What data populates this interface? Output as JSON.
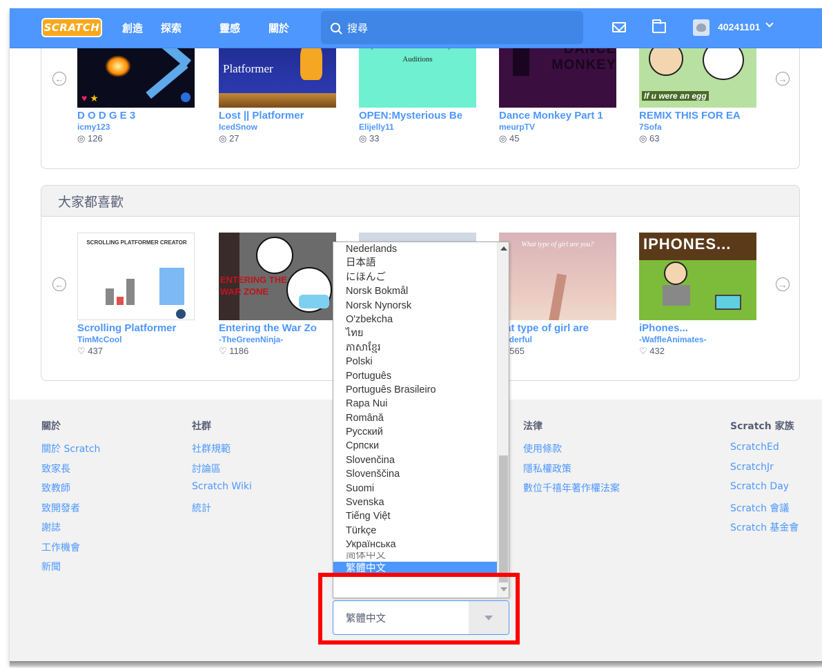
{
  "nav": {
    "logo": "SCRATCH",
    "links": [
      "創造",
      "探索",
      "靈感",
      "關於"
    ],
    "search_placeholder": "搜尋",
    "username": "40241101"
  },
  "top_row": [
    {
      "title": "D O D G E 3",
      "author": "icmy123",
      "stat": "126",
      "thumb_text": ""
    },
    {
      "title": "Lost || Platformer",
      "author": "IcedSnow",
      "stat": "27",
      "thumb_text": "Platformer"
    },
    {
      "title": "OPEN:Mysterious Be",
      "author": "Elijelly11",
      "stat": "33",
      "thumb_text": "Mysterious Benedict Society Voice Auditions"
    },
    {
      "title": "Dance Monkey Part 1",
      "author": "meurpTV",
      "stat": "45",
      "thumb_text": "DANCE MONKEY"
    },
    {
      "title": "REMIX THIS FOR EA",
      "author": "7Sofa",
      "stat": "63",
      "thumb_text": "If u were an egg"
    }
  ],
  "section2": {
    "title": "大家都喜歡",
    "cards": [
      {
        "title": "Scrolling Platformer",
        "author": "TimMcCool",
        "stat": "437",
        "thumb_text": "SCROLLING PLATFORMER CREATOR"
      },
      {
        "title": "Entering the War Zo",
        "author": "-TheGreenNinja-",
        "stat": "1186",
        "thumb_text": "ENTERING THE WAR ZONE"
      },
      {
        "title": "",
        "author": "",
        "stat": "",
        "thumb_text": ""
      },
      {
        "title": "hat type of girl are",
        "author": "onderful",
        "stat": "565",
        "thumb_text": "What type of girl are you?"
      },
      {
        "title": "iPhones...",
        "author": "-WaffleAnimates-",
        "stat": "432",
        "thumb_text": "IPHONES..."
      }
    ]
  },
  "footer": {
    "about": {
      "head": "關於",
      "links": [
        "關於 Scratch",
        "致家長",
        "致教師",
        "致開發者",
        "謝誌",
        "工作機會",
        "新聞"
      ]
    },
    "community": {
      "head": "社群",
      "links": [
        "社群規範",
        "討論區",
        "Scratch Wiki",
        "統計"
      ]
    },
    "legal": {
      "head": "法律",
      "links": [
        "使用條款",
        "隱私權政策",
        "數位千禧年著作權法案"
      ]
    },
    "family": {
      "head": "Scratch 家族",
      "links": [
        "ScratchEd",
        "ScratchJr",
        "Scratch Day",
        "Scratch 會議",
        "Scratch 基金會"
      ]
    }
  },
  "language_options": [
    "Nederlands",
    "日本語",
    "にほんご",
    "Norsk Bokmål",
    "Norsk Nynorsk",
    "O'zbekcha",
    "ไทย",
    "ភាសាខ្មែរ",
    "Polski",
    "Português",
    "Português Brasileiro",
    "Rapa Nui",
    "Română",
    "Русский",
    "Српски",
    "Slovenčina",
    "Slovenščina",
    "Suomi",
    "Svenska",
    "Tiếng Việt",
    "Türkçe",
    "Українська",
    "简体中文",
    "繁體中文"
  ],
  "selected_language": "繁體中文",
  "colors": {
    "nav": "#4d97ff",
    "highlight": "#ff0000",
    "link": "#4d97ff"
  }
}
